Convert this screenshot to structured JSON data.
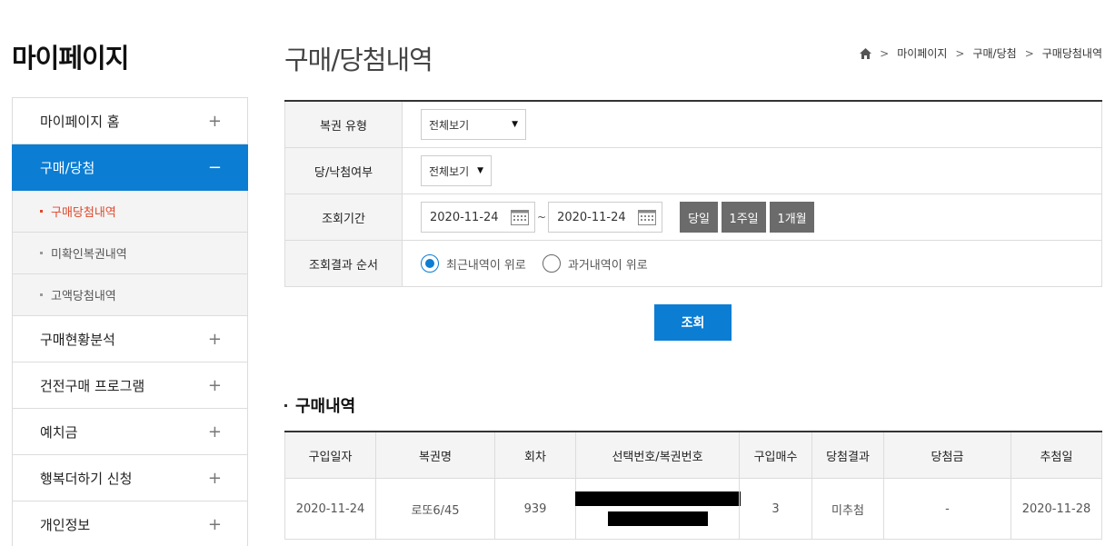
{
  "sidebar": {
    "title": "마이페이지",
    "items": [
      {
        "label": "마이페이지 홈",
        "sign": "+"
      },
      {
        "label": "구매/당첨",
        "sign": "−"
      },
      {
        "label": "구매현황분석",
        "sign": "+"
      },
      {
        "label": "건전구매 프로그램",
        "sign": "+"
      },
      {
        "label": "예치금",
        "sign": "+"
      },
      {
        "label": "행복더하기 신청",
        "sign": "+"
      },
      {
        "label": "개인정보",
        "sign": "+"
      }
    ],
    "sub_items": [
      {
        "label": "구매당첨내역"
      },
      {
        "label": "미확인복권내역"
      },
      {
        "label": "고액당첨내역"
      }
    ]
  },
  "header": {
    "title": "구매/당첨내역",
    "breadcrumb": [
      "마이페이지",
      "구매/당첨",
      "구매당첨내역"
    ]
  },
  "search": {
    "lottery_type_label": "복권 유형",
    "lottery_type_value": "전체보기",
    "win_status_label": "당/낙첨여부",
    "win_status_value": "전체보기",
    "period_label": "조회기간",
    "date_from": "2020-11-24",
    "date_sep": "~",
    "date_to": "2020-11-24",
    "period_buttons": [
      "당일",
      "1주일",
      "1개월"
    ],
    "order_label": "조회결과 순서",
    "order_options": [
      "최근내역이 위로",
      "과거내역이 위로"
    ],
    "submit_label": "조회"
  },
  "results": {
    "title": "구매내역",
    "columns": [
      "구입일자",
      "복권명",
      "회차",
      "선택번호/복권번호",
      "구입매수",
      "당첨결과",
      "당첨금",
      "추첨일"
    ],
    "rows": [
      {
        "date": "2020-11-24",
        "name": "로또6/45",
        "round": "939",
        "count": "3",
        "result": "미추첨",
        "prize": "-",
        "draw_date": "2020-11-28"
      }
    ]
  },
  "colors": {
    "accent": "#0b7dd3",
    "current_sub": "#e0482b",
    "period_button": "#6b6b6b"
  }
}
